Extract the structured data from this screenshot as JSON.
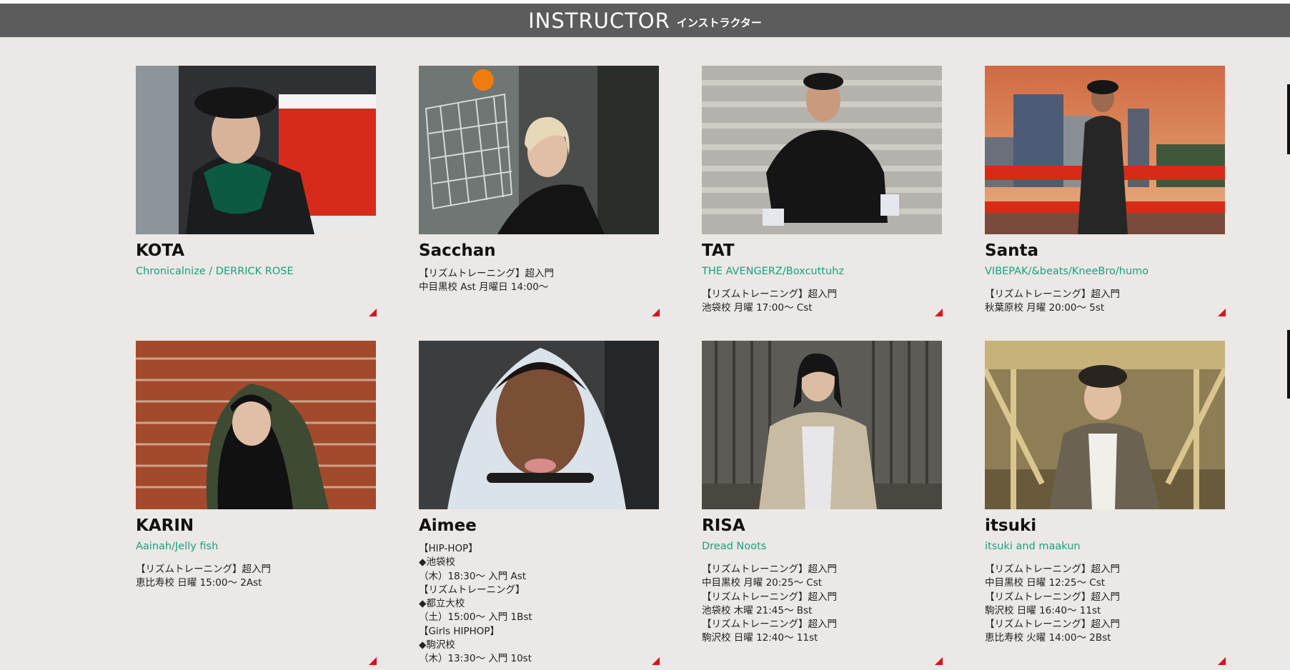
{
  "header": {
    "title_en": "INSTRUCTOR",
    "title_ja": "インストラクター"
  },
  "colors": {
    "header_bg": "#5c5c5c",
    "background": "#ebe8e5",
    "team_text": "#1aa17e",
    "corner_accent": "#d9121c"
  },
  "instructors": [
    {
      "name": "KOTA",
      "team": "Chronicalnize / DERRICK ROSE",
      "schedule": []
    },
    {
      "name": "Sacchan",
      "team": "",
      "schedule": [
        "【リズムトレーニング】超入門",
        "中目黒校 Ast 月曜日 14:00〜"
      ]
    },
    {
      "name": "TAT",
      "team": "THE AVENGERZ/Boxcuttuhz",
      "schedule": [
        "【リズムトレーニング】超入門",
        "池袋校 月曜 17:00〜 Cst"
      ]
    },
    {
      "name": "Santa",
      "team": "VIBEPAK/&beats/KneeBro/humo",
      "schedule": [
        "【リズムトレーニング】超入門",
        "秋葉原校 月曜 20:00〜 5st"
      ]
    },
    {
      "name": "KARIN",
      "team": "Aainah/Jelly fish",
      "schedule": [
        "【リズムトレーニング】超入門",
        "恵比寿校 日曜 15:00〜 2Ast"
      ]
    },
    {
      "name": "Aimee",
      "team": "",
      "schedule": [
        "【HIP-HOP】",
        "◆池袋校",
        "（木）18:30〜 入門 Ast",
        "【リズムトレーニング】",
        "◆都立大校",
        "（土）15:00〜 入門 1Bst",
        "【Girls HIPHOP】",
        "◆駒沢校",
        "（木）13:30〜 入門 10st"
      ]
    },
    {
      "name": "RISA",
      "team": "Dread Noots",
      "schedule": [
        "【リズムトレーニング】超入門",
        "中目黒校 月曜 20:25〜 Cst",
        "【リズムトレーニング】超入門",
        "池袋校 木曜 21:45〜 Bst",
        "【リズムトレーニング】超入門",
        "駒沢校 日曜 12:40〜 11st"
      ]
    },
    {
      "name": "itsuki",
      "team": "itsuki and maakun",
      "schedule": [
        "【リズムトレーニング】超入門",
        "中目黒校 日曜 12:25〜 Cst",
        "【リズムトレーニング】超入門",
        "駒沢校 日曜 16:40〜 11st",
        "【リズムトレーニング】超入門",
        "恵比寿校 火曜 14:00〜 2Bst"
      ]
    }
  ]
}
